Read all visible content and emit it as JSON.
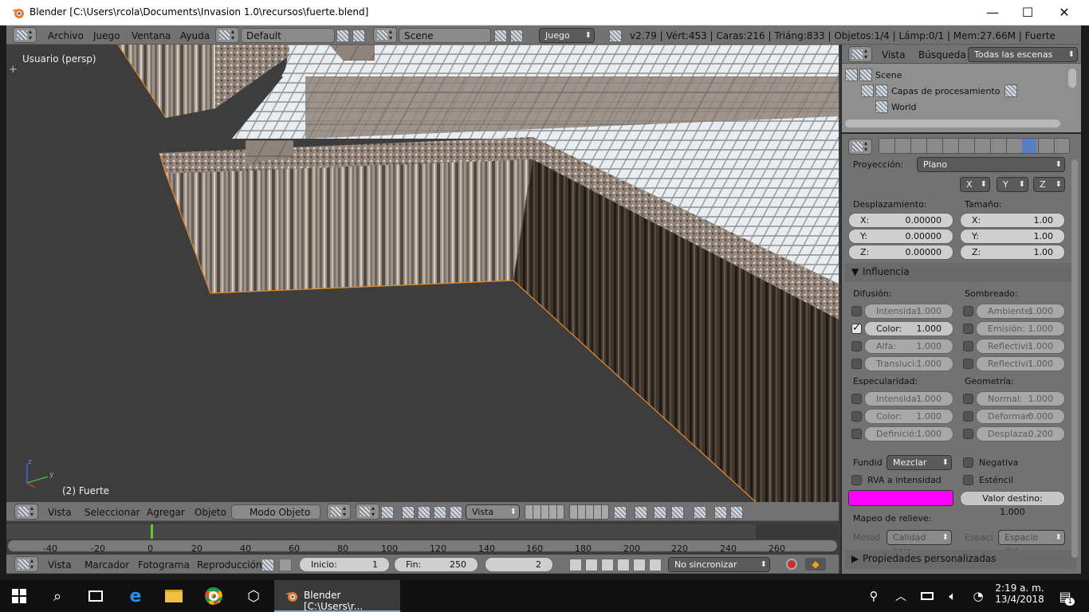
{
  "window": {
    "title": "Blender [C:\\Users\\rcola\\Documents\\Invasion 1.0\\recursos\\fuerte.blend]",
    "minimize": "—",
    "maximize": "☐",
    "close": "✕"
  },
  "info_header": {
    "menus": [
      "Archivo",
      "Juego",
      "Ventana",
      "Ayuda"
    ],
    "layout": "Default",
    "scene": "Scene",
    "engine": "Juego",
    "stats": "v2.79 | Vért:453 | Caras:216 | Triáng:833 | Objetos:1/4 | Lámp:0/1 | Mem:27.66M | Fuerte"
  },
  "viewport": {
    "view_label": "Usuario (persp)",
    "object_label": "(2) Fuerte",
    "plus": "+",
    "axis_z": "z",
    "axis_y": "y"
  },
  "view3d_header": {
    "menus": [
      "Vista",
      "Seleccionar",
      "Agregar",
      "Objeto"
    ],
    "mode": "Modo Objeto",
    "orientation": "Vista"
  },
  "timeline": {
    "ticks": [
      "-40",
      "-20",
      "0",
      "20",
      "40",
      "60",
      "80",
      "100",
      "120",
      "140",
      "160",
      "180",
      "200",
      "220",
      "240",
      "260"
    ],
    "current_frame_marker": 2,
    "menus": [
      "Vista",
      "Marcador",
      "Fotograma",
      "Reproducción"
    ],
    "start_label": "Inicio:",
    "start_value": "1",
    "end_label": "Fin:",
    "end_value": "250",
    "current": "2",
    "sync": "No sincronizar"
  },
  "outliner": {
    "menus": [
      "Vista",
      "Búsqueda"
    ],
    "filter": "Todas las escenas",
    "items": [
      "Scene",
      "Capas de procesamiento",
      "World"
    ]
  },
  "properties": {
    "projection_label": "Proyección:",
    "projection_value": "Plano",
    "axes": [
      "X",
      "Y",
      "Z"
    ],
    "offset_label": "Desplazamiento:",
    "size_label": "Tamaño:",
    "offset": [
      {
        "axis": "X:",
        "value": "0.00000"
      },
      {
        "axis": "Y:",
        "value": "0.00000"
      },
      {
        "axis": "Z:",
        "value": "0.00000"
      }
    ],
    "size": [
      {
        "axis": "X:",
        "value": "1.00"
      },
      {
        "axis": "Y:",
        "value": "1.00"
      },
      {
        "axis": "Z:",
        "value": "1.00"
      }
    ],
    "influence_panel": "Influencia",
    "diffusion_label": "Difusión:",
    "shading_label": "Sombreado:",
    "diffusion": [
      {
        "label": "Intensida:",
        "value": "1.000",
        "checked": false
      },
      {
        "label": "Color:",
        "value": "1.000",
        "checked": true
      },
      {
        "label": "Alfa:",
        "value": "1.000",
        "checked": false
      },
      {
        "label": "Transluci:",
        "value": "1.000",
        "checked": false
      }
    ],
    "shading": [
      {
        "label": "Ambiente:",
        "value": "1.000"
      },
      {
        "label": "Emisión:",
        "value": "1.000"
      },
      {
        "label": "Reflectivi:",
        "value": "1.000"
      },
      {
        "label": "Reflectivi:",
        "value": "1.000"
      }
    ],
    "specular_label": "Especularidad:",
    "geometry_label": "Geometría:",
    "specular": [
      {
        "label": "Intensida:",
        "value": "1.000"
      },
      {
        "label": "Color:",
        "value": "1.000"
      },
      {
        "label": "Definició:",
        "value": "1.000"
      }
    ],
    "geometry": [
      {
        "label": "Normal:",
        "value": "1.000"
      },
      {
        "label": "Deformar:",
        "value": "0.000"
      },
      {
        "label": "Desplaza:",
        "value": "0.200"
      }
    ],
    "blend_label": "Fundid",
    "blend_value": "Mezclar",
    "negative_label": "Negativa",
    "rgb_to_intensity_label": "RVA a intensidad",
    "stencil_label": "Esténcil",
    "color_swatch": "#ff00ff",
    "dest_value": "Valor destino: 1.000",
    "bump_label": "Mapeo de relieve:",
    "method_label": "Métod",
    "method_value": "Calidad baja",
    "space_label": "Espaci",
    "space_value": "Espacio del...",
    "custom_props": "Propiedades personalizadas"
  },
  "taskbar": {
    "active_app": "Blender [C:\\Users\\r...",
    "time": "2:19 a. m.",
    "date": "13/4/2018",
    "notifications": "1"
  },
  "colors": {
    "accent_selection": "#e0862a",
    "panel": "#727272",
    "viewport": "#3d3d3d"
  }
}
